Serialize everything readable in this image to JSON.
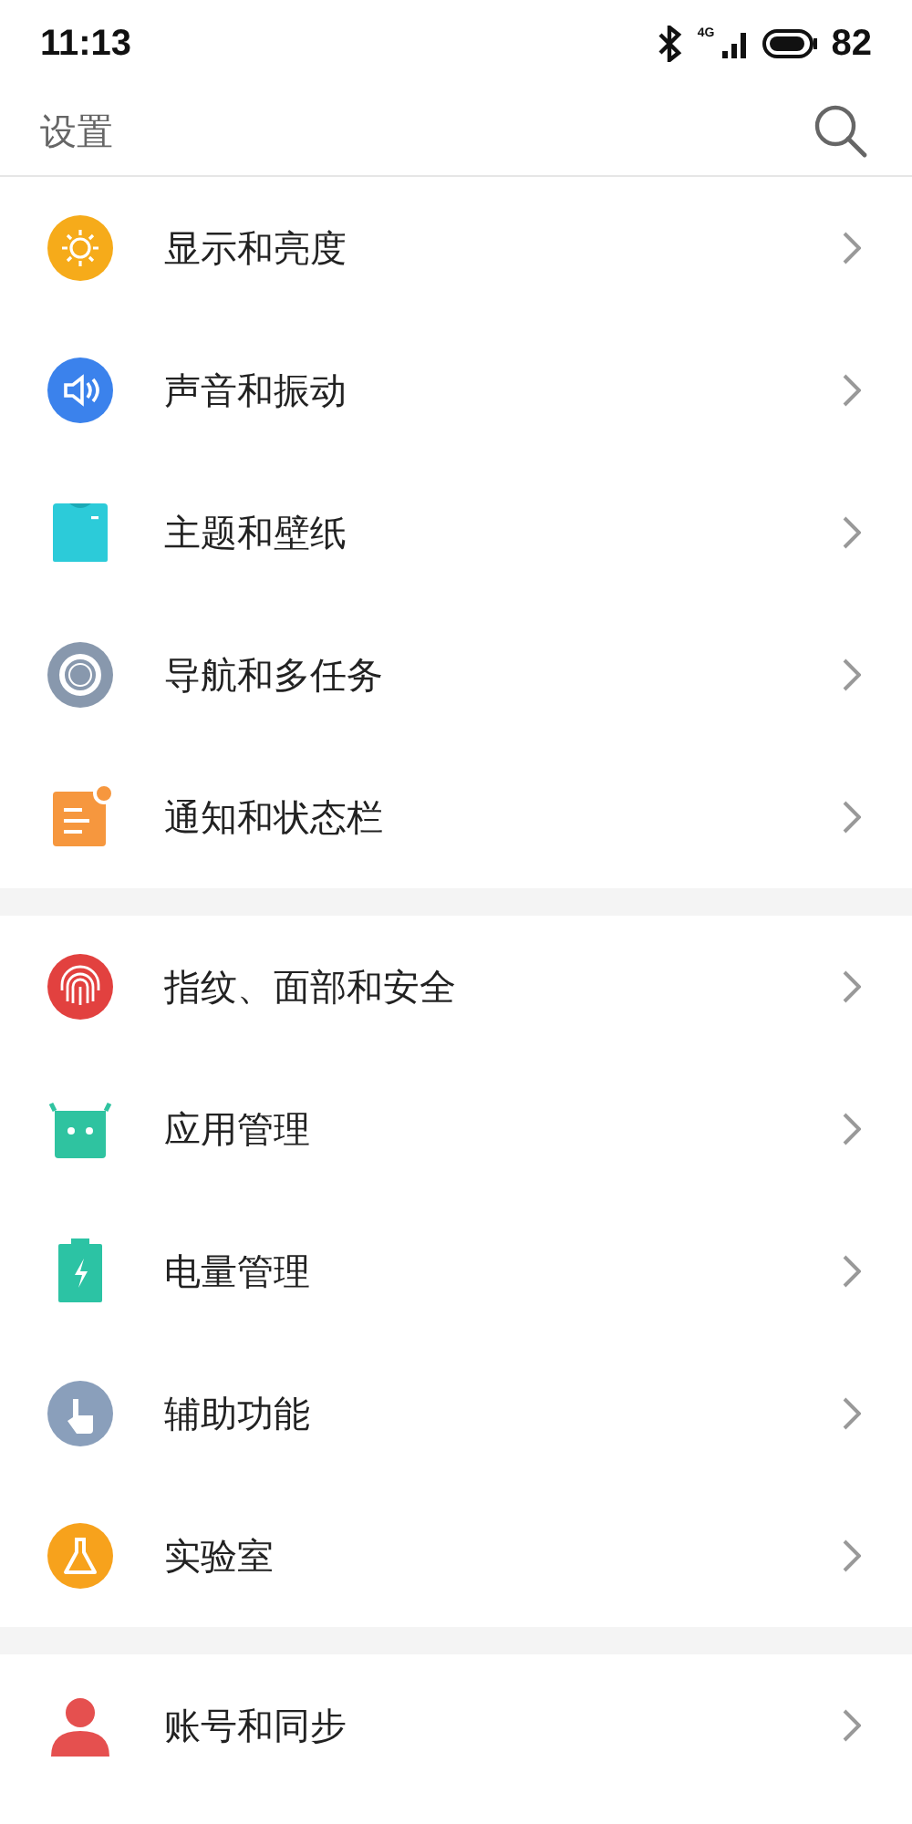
{
  "status_bar": {
    "time": "11:13",
    "network": "4G",
    "battery": "82"
  },
  "header": {
    "title": "设置"
  },
  "groups": [
    {
      "items": [
        {
          "label": "显示和亮度",
          "color": "#f6ab1a"
        },
        {
          "label": "声音和振动",
          "color": "#3b82ec"
        },
        {
          "label": "主题和壁纸",
          "color": "#2ccbd9"
        },
        {
          "label": "导航和多任务",
          "color": "#8898ad"
        },
        {
          "label": "通知和状态栏",
          "color": "#f6973e"
        }
      ]
    },
    {
      "items": [
        {
          "label": "指纹、面部和安全",
          "color": "#e2413f"
        },
        {
          "label": "应用管理",
          "color": "#2fc3a0"
        },
        {
          "label": "电量管理",
          "color": "#2cc3a4"
        },
        {
          "label": "辅助功能",
          "color": "#8a9fbb"
        },
        {
          "label": "实验室",
          "color": "#f7a21c"
        }
      ]
    },
    {
      "items": [
        {
          "label": "账号和同步",
          "color": "#e5504f"
        }
      ]
    }
  ]
}
